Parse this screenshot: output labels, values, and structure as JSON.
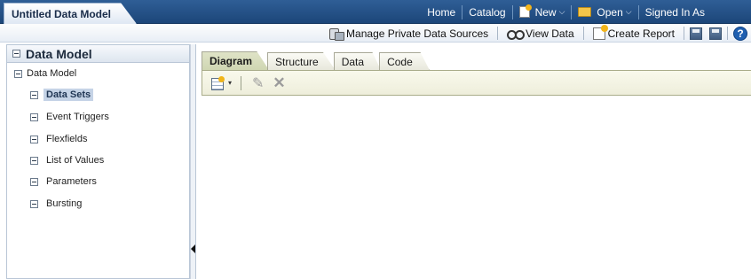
{
  "header": {
    "doc_tab": "Untitled Data Model",
    "nav": {
      "home": "Home",
      "catalog": "Catalog",
      "new": "New",
      "open": "Open",
      "signed_in": "Signed In As"
    }
  },
  "toolbar": {
    "manage_sources": "Manage Private Data Sources",
    "view_data": "View Data",
    "create_report": "Create Report"
  },
  "sidebar": {
    "title": "Data Model",
    "root": "Data Model",
    "items": [
      {
        "label": "Data Sets",
        "selected": true
      },
      {
        "label": "Event Triggers"
      },
      {
        "label": "Flexfields"
      },
      {
        "label": "List of Values"
      },
      {
        "label": "Parameters"
      },
      {
        "label": "Bursting"
      }
    ]
  },
  "main": {
    "tabs": [
      "Diagram",
      "Structure",
      "Data",
      "Code"
    ],
    "active_tab": "Diagram"
  },
  "colors": {
    "header_blue": "#1c4679",
    "selection": "#c5d3e6",
    "tab_active": "#cfd6b2"
  }
}
